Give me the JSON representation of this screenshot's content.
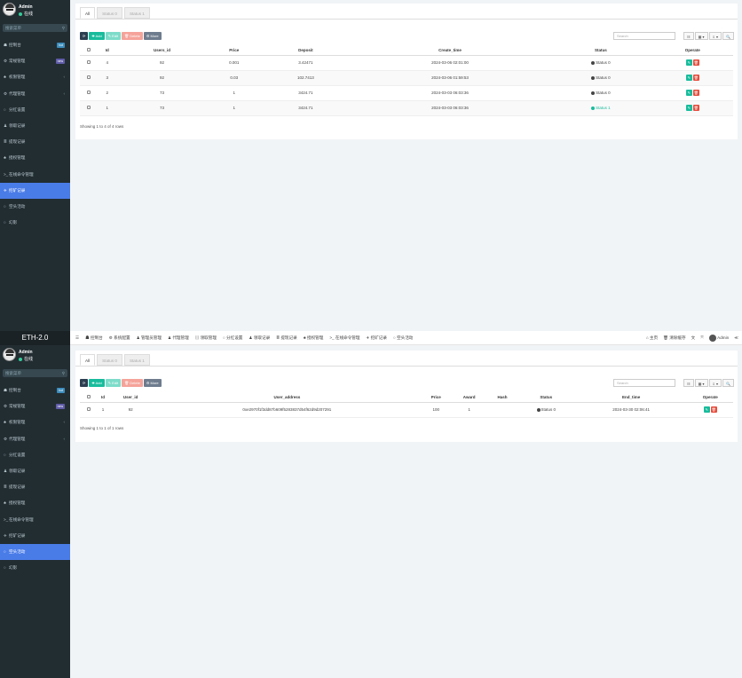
{
  "sidebar_common": {
    "user_name": "Admin",
    "user_status": "在线",
    "search_placeholder": "搜索菜单"
  },
  "panel1": {
    "menu": [
      {
        "icon": "☗",
        "label": "控制台",
        "badge": "hot"
      },
      {
        "icon": "⚙",
        "label": "常规管理",
        "badge": "new"
      },
      {
        "icon": "♣",
        "label": "权限管理",
        "caret": "‹"
      },
      {
        "icon": "⚙",
        "label": "代理管理",
        "caret": "‹"
      },
      {
        "icon": "○",
        "label": "分红设置"
      },
      {
        "icon": "♟",
        "label": "领取记录"
      },
      {
        "icon": "≣",
        "label": "提现记录"
      },
      {
        "icon": "♣",
        "label": "授权管理"
      },
      {
        "icon": ">_",
        "label": "在线命令管理"
      },
      {
        "icon": "✈",
        "label": "挖矿记录",
        "active": true
      },
      {
        "icon": "○",
        "label": "空头活动"
      },
      {
        "icon": "○",
        "label": "幻影"
      }
    ],
    "tabs": [
      "All",
      "Status 0",
      "Status 1"
    ],
    "toolbar": {
      "refresh": "⟳",
      "add": "✚ Add",
      "edit": "✎ Edit",
      "delete": "🗑 Delete",
      "more": "⚙ More"
    },
    "search_placeholder": "Search",
    "tools": [
      "☷",
      "▦ ▾",
      "⇩ ▾",
      "🔍"
    ],
    "columns": [
      "Id",
      "Users_id",
      "Price",
      "Deposit",
      "Create_time",
      "Status",
      "Operate"
    ],
    "rows": [
      {
        "id": "4",
        "users_id": "92",
        "price": "0.001",
        "deposit": "3.42471",
        "create_time": "2024-03-06 02:01:00",
        "status": "Status 0"
      },
      {
        "id": "3",
        "users_id": "92",
        "price": "0.03",
        "deposit": "102.7413",
        "create_time": "2024-03-06 01:59:53",
        "status": "Status 0"
      },
      {
        "id": "2",
        "users_id": "73",
        "price": "1",
        "deposit": "3424.71",
        "create_time": "2024-03-03 06:03:36",
        "status": "Status 0"
      },
      {
        "id": "1",
        "users_id": "73",
        "price": "1",
        "deposit": "3424.71",
        "create_time": "2024-03-03 06:03:36",
        "status": "Status 1"
      }
    ],
    "showing": "Showing 1 to 4 of 4 rows"
  },
  "panel2": {
    "brand": "ETH-2.0",
    "topnav": [
      "☰",
      "☗ 控制台",
      "⚙ 系统配置",
      "♟ 管理员管理",
      "♟ 代理管理",
      "▤ 领取管理",
      "○ 分红设置",
      "♟ 领取记录",
      "≣ 提现记录",
      "♣ 授权管理",
      ">_ 在线命令管理",
      "✈ 挖矿记录",
      "○ 空头活动"
    ],
    "topright": [
      "⌂ 主页",
      "🗑 清除缓存",
      "文",
      "⤧"
    ],
    "topright_user": "Admin",
    "topright_last": "≪",
    "menu": [
      {
        "icon": "☗",
        "label": "控制台",
        "badge": "hot"
      },
      {
        "icon": "⚙",
        "label": "常规管理",
        "badge": "new"
      },
      {
        "icon": "♣",
        "label": "权限管理",
        "caret": "‹"
      },
      {
        "icon": "⚙",
        "label": "代理管理",
        "caret": "‹"
      },
      {
        "icon": "○",
        "label": "分红设置"
      },
      {
        "icon": "♟",
        "label": "领取记录"
      },
      {
        "icon": "≣",
        "label": "提现记录"
      },
      {
        "icon": "♣",
        "label": "授权管理"
      },
      {
        "icon": ">_",
        "label": "在线命令管理"
      },
      {
        "icon": "✈",
        "label": "挖矿记录"
      },
      {
        "icon": "○",
        "label": "空头活动",
        "active": true
      },
      {
        "icon": "○",
        "label": "幻影"
      }
    ],
    "tabs": [
      "All",
      "Status 0",
      "Status 1"
    ],
    "toolbar": {
      "refresh": "⟳",
      "add": "✚ Add",
      "edit": "✎ Edit",
      "delete": "🗑 Delete",
      "more": "⚙ More"
    },
    "search_placeholder": "Search",
    "tools": [
      "☷",
      "▦ ▾",
      "⇩ ▾",
      "🔍"
    ],
    "columns": [
      "Id",
      "User_id",
      "User_address",
      "Price",
      "Award",
      "Hash",
      "Status",
      "End_time",
      "Operate"
    ],
    "rows": [
      {
        "id": "1",
        "user_id": "92",
        "user_address": "0xe2970f1f3dd87b609f5283837d54f62d9d207291",
        "price": "100",
        "award": "1",
        "hash": "",
        "status": "Status 0",
        "end_time": "2024-03-30 02:06:41"
      }
    ],
    "showing": "Showing 1 to 1 of 1 rows"
  },
  "colors": {
    "sidebar": "#222d32",
    "active": "#4a7ce8",
    "add": "#18bc9c",
    "delete": "#e74c3c"
  }
}
